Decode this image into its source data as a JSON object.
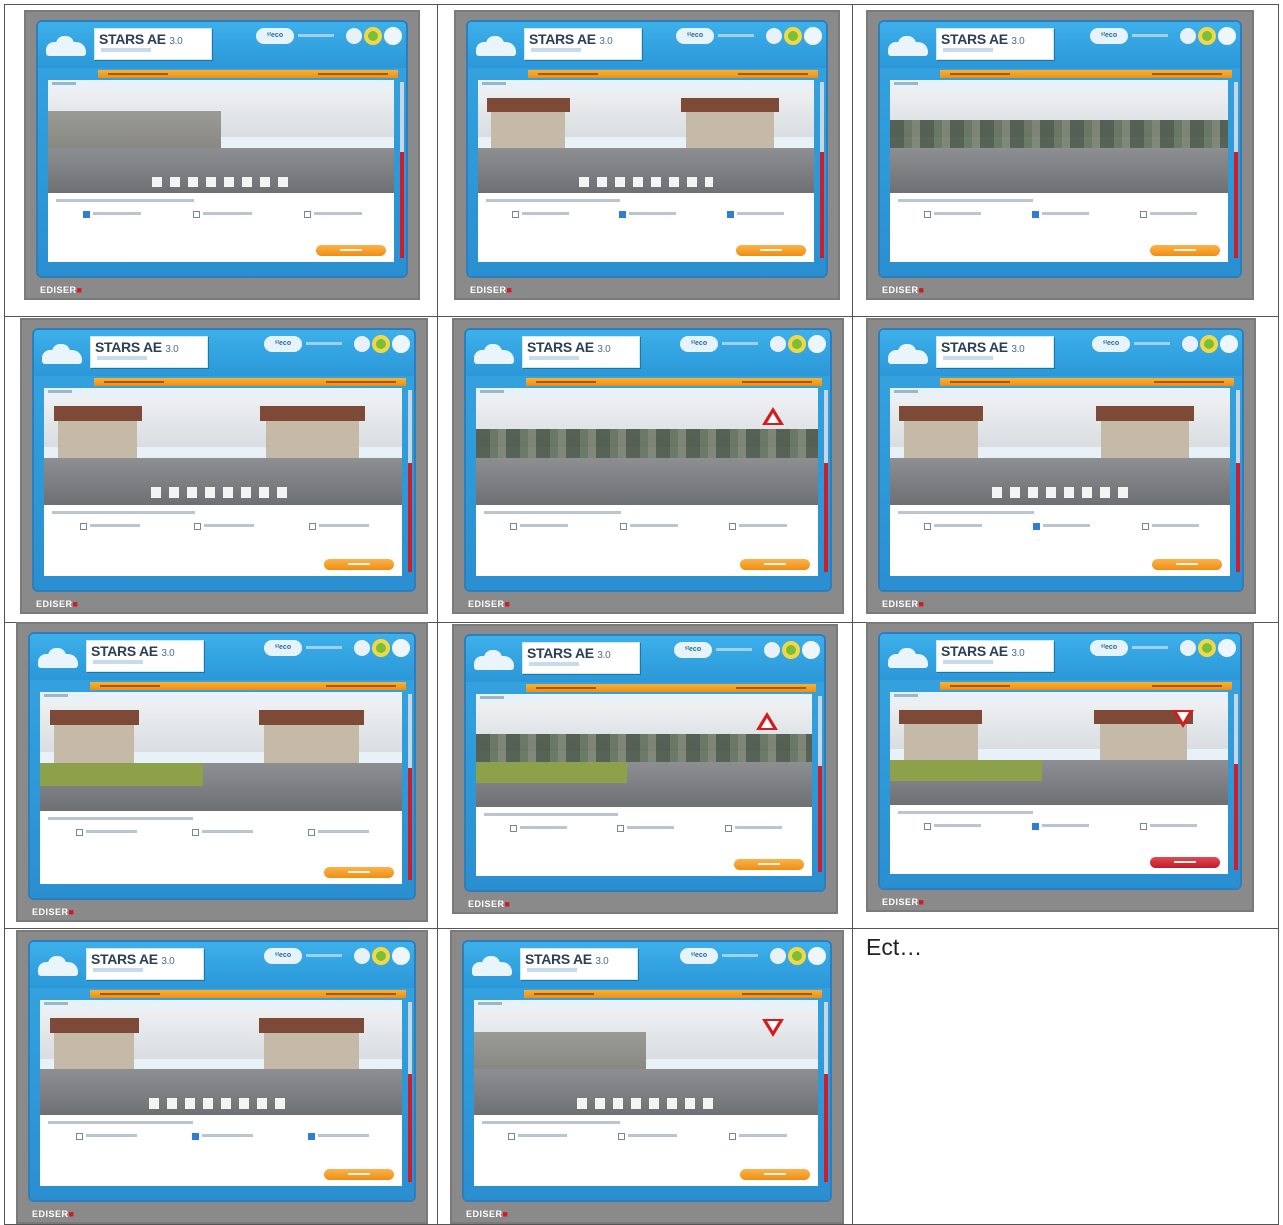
{
  "app": {
    "title": "STARS AE",
    "version": "3.0",
    "eco_badge": "ˢᵗeco",
    "logo_prefix": "EDISER",
    "logo_suffix": "■"
  },
  "footer": {
    "more_text": "Ect…"
  },
  "screens": [
    {
      "id": 1,
      "scene": "wall",
      "sign": "none",
      "answers_selected": [
        0
      ],
      "button_color": "orange"
    },
    {
      "id": 2,
      "scene": "houses",
      "sign": "none",
      "answers_selected": [
        1,
        2
      ],
      "button_color": "orange"
    },
    {
      "id": 3,
      "scene": "trees",
      "sign": "none",
      "answers_selected": [
        1
      ],
      "button_color": "orange"
    },
    {
      "id": 4,
      "scene": "houses",
      "sign": "none",
      "answers_selected": [],
      "button_color": "orange"
    },
    {
      "id": 5,
      "scene": "trees",
      "sign": "crossing",
      "answers_selected": [],
      "button_color": "orange"
    },
    {
      "id": 6,
      "scene": "houses",
      "sign": "none",
      "answers_selected": [
        1
      ],
      "button_color": "orange"
    },
    {
      "id": 7,
      "scene": "junction",
      "sign": "none",
      "answers_selected": [],
      "button_color": "orange"
    },
    {
      "id": 8,
      "scene": "fields",
      "sign": "warning",
      "answers_selected": [],
      "button_color": "orange"
    },
    {
      "id": 9,
      "scene": "junction",
      "sign": "yield",
      "answers_selected": [
        1
      ],
      "button_color": "red"
    },
    {
      "id": 10,
      "scene": "houses",
      "sign": "none",
      "answers_selected": [
        1,
        2
      ],
      "button_color": "orange"
    },
    {
      "id": 11,
      "scene": "wall",
      "sign": "yield",
      "answers_selected": [],
      "button_color": "orange"
    }
  ]
}
